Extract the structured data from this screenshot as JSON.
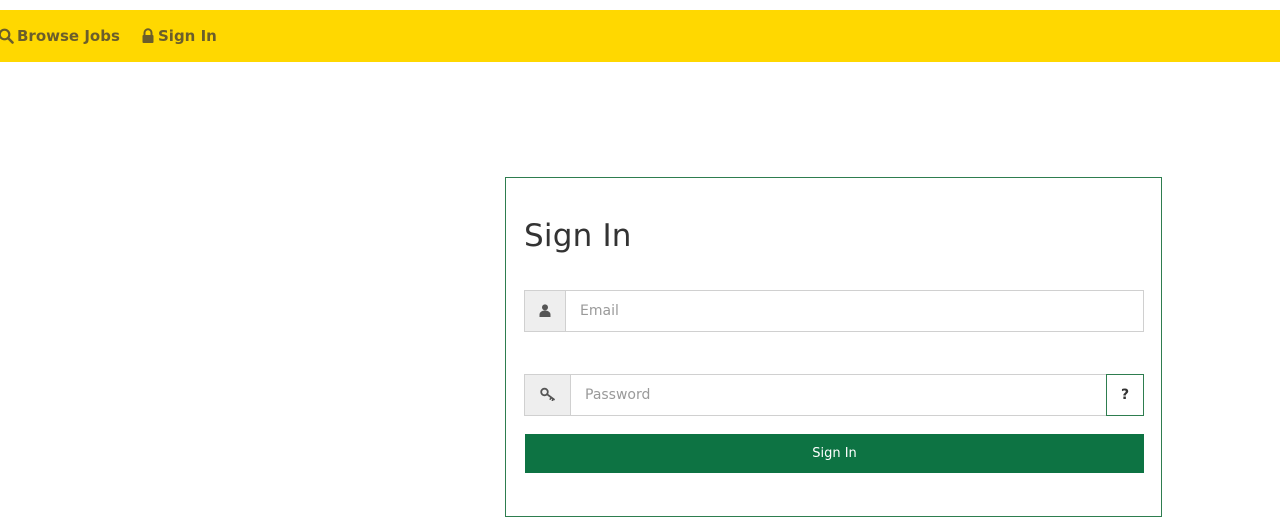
{
  "nav": {
    "browse_label": "Browse Jobs",
    "browse_icon": "search-icon",
    "signin_label": "Sign In",
    "signin_icon": "lock-icon",
    "bar_color": "#ffd800",
    "text_color": "#6b5e2b"
  },
  "signin_card": {
    "title": "Sign In",
    "border_color": "#2e7d4f",
    "email": {
      "icon": "user-icon",
      "value": "",
      "placeholder": "Email"
    },
    "password": {
      "icon": "key-icon",
      "value": "",
      "placeholder": "Password",
      "help_label": "?"
    },
    "submit_label": "Sign In",
    "submit_color": "#0d7343"
  }
}
